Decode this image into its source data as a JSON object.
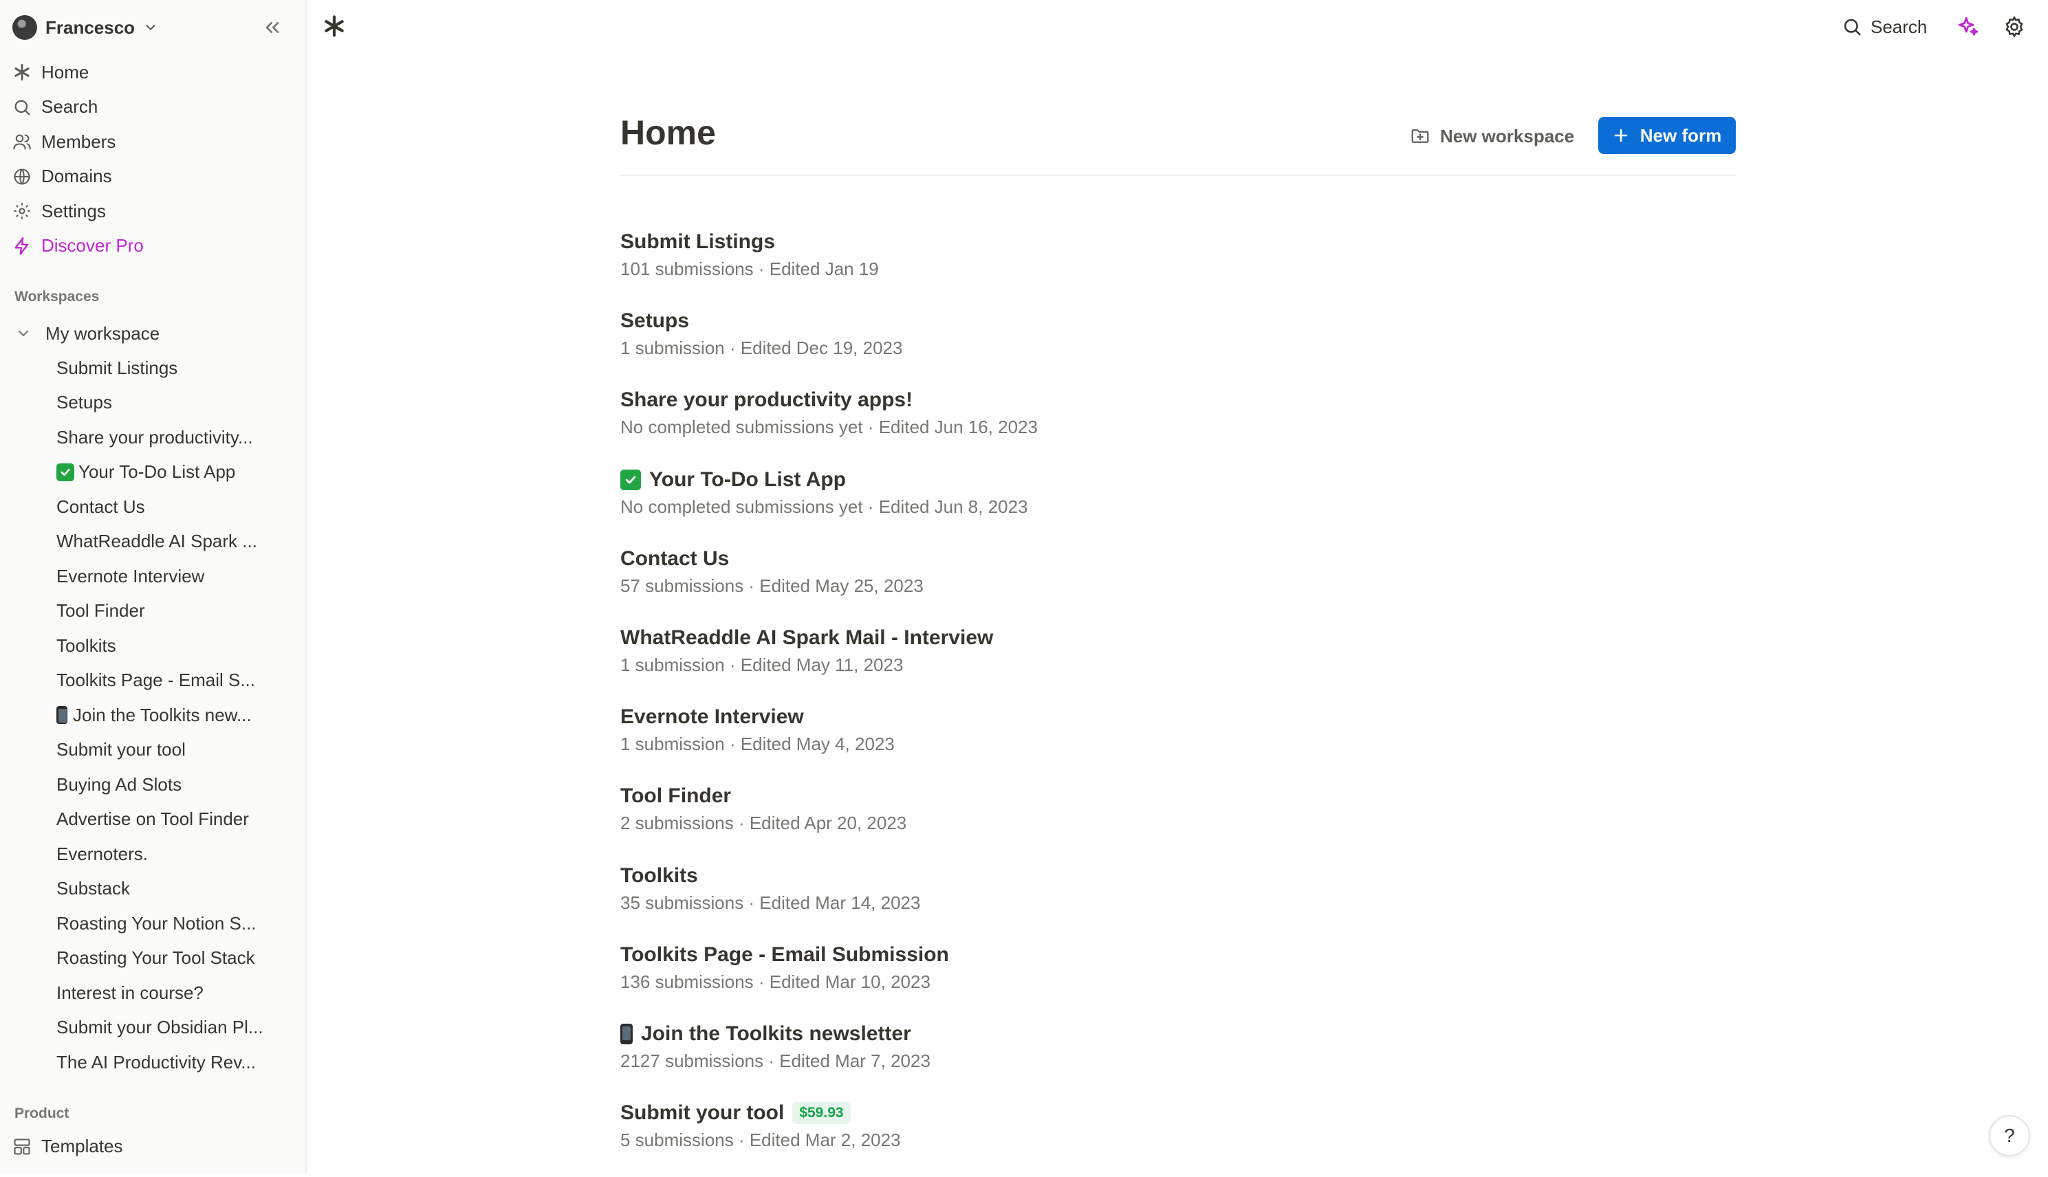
{
  "account": {
    "name": "Francesco"
  },
  "nav": {
    "home": "Home",
    "search": "Search",
    "members": "Members",
    "domains": "Domains",
    "settings": "Settings",
    "discover_pro": "Discover Pro"
  },
  "workspaces_label": "Workspaces",
  "workspace": {
    "name": "My workspace",
    "items": [
      "Submit Listings",
      "Setups",
      "Share your productivity...",
      "Your To-Do List App",
      "Contact Us",
      "WhatReaddle AI Spark ...",
      "Evernote Interview",
      "Tool Finder",
      "Toolkits",
      "Toolkits Page - Email S...",
      "Join the Toolkits new...",
      "Submit your tool",
      "Buying Ad Slots",
      "Advertise on Tool Finder",
      "Evernoters.",
      "Substack",
      "Roasting Your Notion S...",
      "Roasting Your Tool Stack",
      "Interest in course?",
      "Submit your Obsidian Pl...",
      "The AI Productivity Rev..."
    ]
  },
  "product_label": "Product",
  "templates": "Templates",
  "topbar": {
    "search": "Search"
  },
  "main": {
    "title": "Home",
    "new_workspace": "New workspace",
    "new_form": "New form",
    "forms": [
      {
        "title": "Submit Listings",
        "meta": "101 submissions · Edited Jan 19"
      },
      {
        "title": "Setups",
        "meta": "1 submission · Edited Dec 19, 2023"
      },
      {
        "title": "Share your productivity apps!",
        "meta": "No completed submissions yet · Edited Jun 16, 2023"
      },
      {
        "title": "Your To-Do List App",
        "meta": "No completed submissions yet · Edited Jun 8, 2023"
      },
      {
        "title": "Contact Us",
        "meta": "57 submissions · Edited May 25, 2023"
      },
      {
        "title": "WhatReaddle AI Spark Mail - Interview",
        "meta": "1 submission · Edited May 11, 2023"
      },
      {
        "title": "Evernote Interview",
        "meta": "1 submission · Edited May 4, 2023"
      },
      {
        "title": "Tool Finder",
        "meta": "2 submissions · Edited Apr 20, 2023"
      },
      {
        "title": "Toolkits",
        "meta": "35 submissions · Edited Mar 14, 2023"
      },
      {
        "title": "Toolkits Page - Email Submission",
        "meta": "136 submissions · Edited Mar 10, 2023"
      },
      {
        "title": "Join the Toolkits newsletter",
        "meta": "2127 submissions · Edited Mar 7, 2023"
      },
      {
        "title": "Submit your tool",
        "meta": "5 submissions · Edited Mar 2, 2023",
        "badge": "$59.93"
      }
    ]
  },
  "help": "?",
  "colors": {
    "accent": "#0b6ed6",
    "pro": "#c026d3",
    "badge_green": "#16a34a"
  }
}
